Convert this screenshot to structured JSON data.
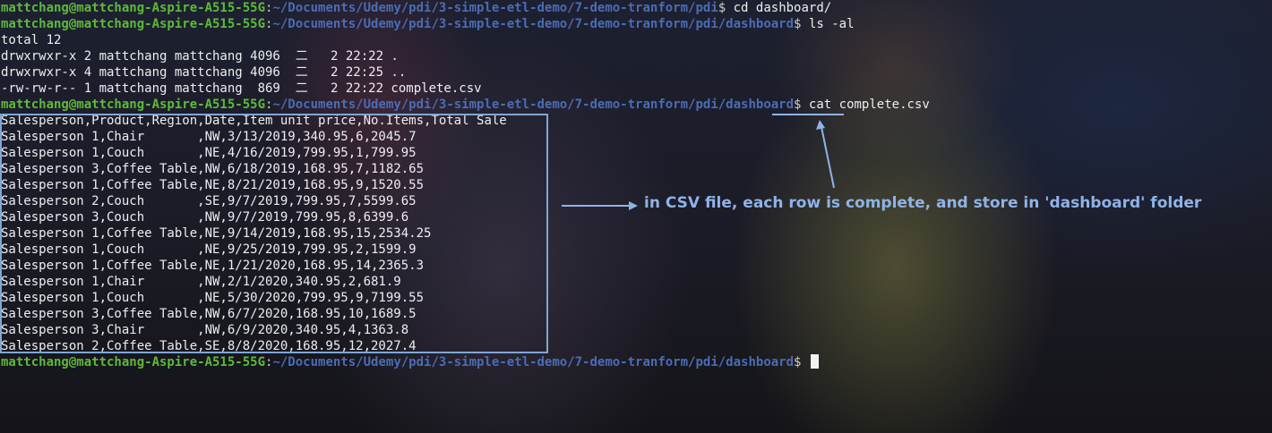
{
  "prompt": {
    "user": "mattchang@mattchang-Aspire-A515-55G",
    "path_pdi": "~/Documents/Udemy/pdi/3-simple-etl-demo/7-demo-tranform/pdi",
    "path_dashboard": "~/Documents/Udemy/pdi/3-simple-etl-demo/7-demo-tranform/pdi/dashboard",
    "symbol": "$"
  },
  "commands": {
    "cd": "cd dashboard/",
    "ls": "ls -al",
    "cat": "cat complete.csv"
  },
  "ls_output": [
    "total 12",
    "drwxrwxr-x 2 mattchang mattchang 4096  二   2 22:22 .",
    "drwxrwxr-x 4 mattchang mattchang 4096  二   2 22:25 ..",
    "-rw-rw-r-- 1 mattchang mattchang  869  二   2 22:22 complete.csv"
  ],
  "csv_lines": [
    "Salesperson,Product,Region,Date,Item unit price,No.Items,Total Sale",
    "Salesperson 1,Chair       ,NW,3/13/2019,340.95,6,2045.7",
    "Salesperson 1,Couch       ,NE,4/16/2019,799.95,1,799.95",
    "Salesperson 3,Coffee Table,NW,6/18/2019,168.95,7,1182.65",
    "Salesperson 1,Coffee Table,NE,8/21/2019,168.95,9,1520.55",
    "Salesperson 2,Couch       ,SE,9/7/2019,799.95,7,5599.65",
    "Salesperson 3,Couch       ,NW,9/7/2019,799.95,8,6399.6",
    "Salesperson 1,Coffee Table,NE,9/14/2019,168.95,15,2534.25",
    "Salesperson 1,Couch       ,NE,9/25/2019,799.95,2,1599.9",
    "Salesperson 1,Coffee Table,NE,1/21/2020,168.95,14,2365.3",
    "Salesperson 1,Chair       ,NW,2/1/2020,340.95,2,681.9",
    "Salesperson 1,Couch       ,NE,5/30/2020,799.95,9,7199.55",
    "Salesperson 3,Coffee Table,NW,6/7/2020,168.95,10,1689.5",
    "Salesperson 3,Chair       ,NW,6/9/2020,340.95,4,1363.8",
    "Salesperson 2,Coffee Table,SE,8/8/2020,168.95,12,2027.4"
  ],
  "annotation": {
    "note": "in CSV file, each row is complete, and store in 'dashboard' folder",
    "color": "#8fb3e6"
  },
  "colors": {
    "prompt_user": "#5fb93a",
    "prompt_path": "#4b6cb5",
    "text": "#eeeeee",
    "box": "#7fa7d6"
  }
}
